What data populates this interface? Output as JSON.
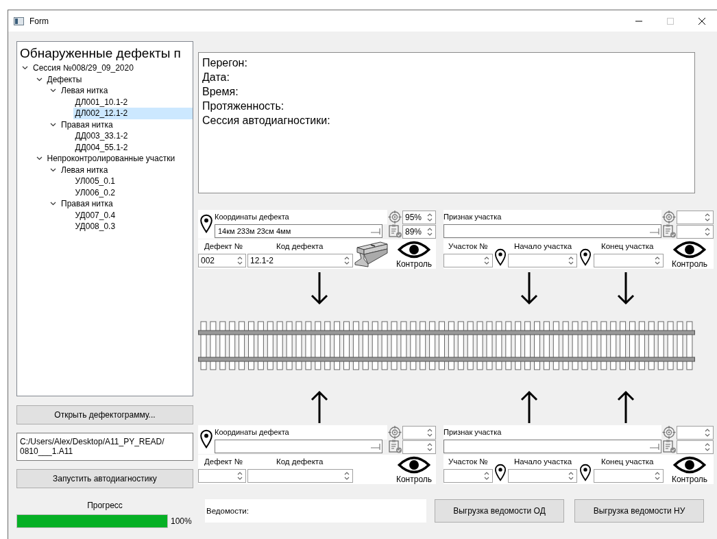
{
  "window": {
    "title": "Form"
  },
  "tree": {
    "header": "Обнаруженные дефекты п",
    "items": [
      {
        "label": "Сессия №008/29_09_2020",
        "expanded": true,
        "selected": false,
        "children": [
          {
            "label": "Дефекты",
            "expanded": true,
            "selected": false,
            "children": [
              {
                "label": "Левая нитка",
                "expanded": true,
                "selected": false,
                "children": [
                  {
                    "label": "ДЛ001_10.1-2",
                    "selected": false
                  },
                  {
                    "label": "ДЛ002_12.1-2",
                    "selected": true
                  }
                ]
              },
              {
                "label": "Правая нитка",
                "expanded": true,
                "selected": false,
                "children": [
                  {
                    "label": "ДД003_33.1-2",
                    "selected": false
                  },
                  {
                    "label": "ДД004_55.1-2",
                    "selected": false
                  }
                ]
              }
            ]
          },
          {
            "label": "Непроконтролированные участки",
            "expanded": true,
            "selected": false,
            "children": [
              {
                "label": "Левая нитка",
                "expanded": true,
                "selected": false,
                "children": [
                  {
                    "label": "УЛ005_0.1",
                    "selected": false
                  },
                  {
                    "label": "УЛ006_0.2",
                    "selected": false
                  }
                ]
              },
              {
                "label": "Правая нитка",
                "expanded": true,
                "selected": false,
                "children": [
                  {
                    "label": "УД007_0.4",
                    "selected": false
                  },
                  {
                    "label": "УД008_0.3",
                    "selected": false
                  }
                ]
              }
            ]
          }
        ]
      }
    ]
  },
  "open_button": "Открыть дефектограмму...",
  "file_path": [
    "C:/Users/Alex/Desktop/A11_PY_READ/",
    "0810___1.A11"
  ],
  "run_button": "Запустить автодиагностику",
  "progress": {
    "label": "Прогресс",
    "level": 1,
    "reading": "100%"
  },
  "info_box": {
    "lines": [
      "Перегон:",
      "Дата:",
      "Время:",
      "Протяженность:",
      "Сессия автодиагностики:"
    ]
  },
  "defect_panels": [
    {
      "coord_label": "Координаты дефекта",
      "coord_value": "14км 233м 23см 4мм",
      "scores": [
        "95%",
        "89%"
      ],
      "number_label": "Дефект №",
      "number_value": "002",
      "code_label": "Код дефекта",
      "code_value": "12.1-2",
      "rail_icon": true,
      "control_label": "Контроль"
    },
    {
      "coord_label": "Координаты дефекта",
      "number_label": "Дефект №",
      "code_label": "Код дефекта",
      "control_label": "Контроль"
    }
  ],
  "section_panels": [
    {
      "sign_label": "Признак участка",
      "number_label": "Участок №",
      "start_label": "Начало участка",
      "end_label": "Конец участка",
      "control_label": "Контроль"
    },
    {
      "sign_label": "Признак участка",
      "number_label": "Участок №",
      "start_label": "Начало участка",
      "end_label": "Конец участка",
      "control_label": "Контроль"
    }
  ],
  "statements": {
    "label": "Ведомости:"
  },
  "export_buttons": [
    "Выгрузка ведомости ОД",
    "Выгрузка ведомости НУ"
  ]
}
